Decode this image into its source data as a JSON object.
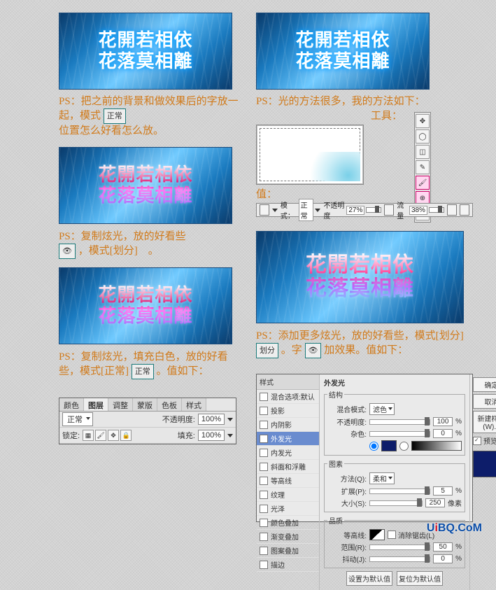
{
  "banners": {
    "line1": "花開若相依",
    "line2": "花落莫相離"
  },
  "notes": {
    "n1": "PS：把之前的背景和做效果后的字放一起，模式",
    "n1b": "位置怎么好看怎么放。",
    "n1_tag": "正常",
    "n2": "PS：光的方法很多，我的方法如下：",
    "n2_tool": "工具：",
    "n2_value": "值：",
    "n3a": "PS：复制炫光，放的好看些",
    "n3b_prefix": "，模式[",
    "n3b_mode": "划分",
    "n3b_suffix": "]　。",
    "n4a": "PS：添加更多炫光，放的好看些，模式[",
    "n4_mode": "划分",
    "n4b": "]",
    "n4_tag": "划分",
    "n4c": "。字",
    "n4d": "加效果。值如下：",
    "n5a": "PS：复制炫光，填充白色，放的好看些，模式[",
    "n5_mode": "正常",
    "n5b": "]",
    "n5_tag": "正常",
    "n5c": "。值如下："
  },
  "optionbar": {
    "mode_label": "模式：",
    "mode_value": "正常",
    "opacity_label": "不透明度",
    "opacity_value": "27%",
    "flow_label": "流量",
    "flow_value": "38%"
  },
  "layerpanel": {
    "tabs": [
      "颜色",
      "图层",
      "调整",
      "蒙版",
      "色板",
      "样式"
    ],
    "active_tab_index": 1,
    "mode": "正常",
    "opacity_label": "不透明度:",
    "opacity_value": "100%",
    "lock_label": "锁定:",
    "fill_label": "填充:",
    "fill_value": "100%"
  },
  "fxpanel": {
    "left_header": "样式",
    "items": [
      {
        "label": "混合选项:默认",
        "checked": false
      },
      {
        "label": "投影",
        "checked": false
      },
      {
        "label": "内阴影",
        "checked": false
      },
      {
        "label": "外发光",
        "checked": true,
        "selected": true
      },
      {
        "label": "内发光",
        "checked": false
      },
      {
        "label": "斜面和浮雕",
        "checked": false
      },
      {
        "label": "等高线",
        "checked": false
      },
      {
        "label": "纹理",
        "checked": false
      },
      {
        "label": "光泽",
        "checked": false
      },
      {
        "label": "颜色叠加",
        "checked": false
      },
      {
        "label": "渐变叠加",
        "checked": false
      },
      {
        "label": "图案叠加",
        "checked": false
      },
      {
        "label": "描边",
        "checked": false
      }
    ],
    "section_title": "外发光",
    "group_struct": "结构",
    "blendmode_label": "混合模式:",
    "blendmode_value": "滤色",
    "opacity_label": "不透明度:",
    "opacity_value": "100",
    "noise_label": "杂色:",
    "noise_value": "0",
    "group_elem": "图素",
    "method_label": "方法(Q):",
    "method_value": "柔和",
    "spread_label": "扩展(P):",
    "spread_value": "5",
    "size_label": "大小(S):",
    "size_value": "250",
    "unit_pct": "%",
    "unit_px": "像素",
    "group_qual": "品质",
    "contour_label": "等高线:",
    "anti_label": "消除锯齿(L)",
    "range_label": "范围(R):",
    "range_value": "50",
    "jitter_label": "抖动(J):",
    "jitter_value": "0",
    "make_default": "设置为默认值",
    "reset_default": "复位为默认值",
    "btn_ok": "确定",
    "btn_cancel": "取消",
    "btn_newstyle": "新建样式(W)...",
    "preview_label": "预览(V)"
  },
  "eye_icon": "👁",
  "watermark": {
    "u": "U",
    "i": "i",
    "rest": "BQ.CoM"
  }
}
